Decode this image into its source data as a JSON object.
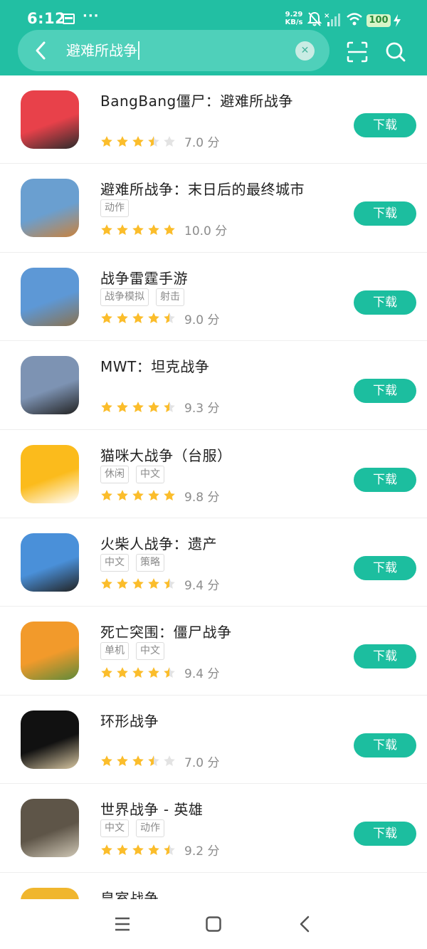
{
  "status_bar": {
    "time": "6:12",
    "more": "···",
    "net_speed_value": "9.29",
    "net_speed_unit": "KB/s",
    "battery": "100"
  },
  "search": {
    "query": "避难所战争"
  },
  "download_label": "下载",
  "apps": [
    {
      "name": "BangBang僵尸：避难所战争",
      "tags": [],
      "rating": 3.5,
      "score": "7.0 分",
      "icon_colors": [
        "#e8414a",
        "#2b2b2b"
      ]
    },
    {
      "name": "避难所战争：末日后的最终城市",
      "tags": [
        "动作"
      ],
      "rating": 5,
      "score": "10.0 分",
      "icon_colors": [
        "#6a9fd0",
        "#c9823d"
      ]
    },
    {
      "name": "战争雷霆手游",
      "tags": [
        "战争模拟",
        "射击"
      ],
      "rating": 4.5,
      "score": "9.0 分",
      "icon_colors": [
        "#5d98d6",
        "#8a7250"
      ]
    },
    {
      "name": "MWT：坦克战争",
      "tags": [],
      "rating": 4.5,
      "score": "9.3 分",
      "icon_colors": [
        "#7d93b3",
        "#222222"
      ]
    },
    {
      "name": "猫咪大战争（台服）",
      "tags": [
        "休闲",
        "中文"
      ],
      "rating": 5,
      "score": "9.8 分",
      "icon_colors": [
        "#fbbb1c",
        "#ffffff"
      ]
    },
    {
      "name": "火柴人战争：遗产",
      "tags": [
        "中文",
        "策略"
      ],
      "rating": 4.5,
      "score": "9.4 分",
      "icon_colors": [
        "#4a90d9",
        "#222222"
      ]
    },
    {
      "name": "死亡突围：僵尸战争",
      "tags": [
        "单机",
        "中文"
      ],
      "rating": 4.5,
      "score": "9.4 分",
      "icon_colors": [
        "#f29a2b",
        "#5e8a3a"
      ]
    },
    {
      "name": "环形战争",
      "tags": [],
      "rating": 3.5,
      "score": "7.0 分",
      "icon_colors": [
        "#111111",
        "#d8c7a2"
      ]
    },
    {
      "name": "世界战争 - 英雄",
      "tags": [
        "中文",
        "动作"
      ],
      "rating": 4.5,
      "score": "9.2 分",
      "icon_colors": [
        "#5e5548",
        "#cfc7b5"
      ]
    },
    {
      "name": "皇室战争",
      "tags": [],
      "rating": 0,
      "score": "",
      "icon_colors": [
        "#f0b62e",
        "#d4462f"
      ]
    }
  ],
  "colors": {
    "accent": "#22bfa3",
    "button": "#1cbe9f",
    "star": "#fbbd2b",
    "star_empty": "#e3e3e3"
  },
  "icons": {
    "back": "chevron-left-icon",
    "clear": "close-icon",
    "scan": "scan-icon",
    "search": "search-icon",
    "nav_menu": "menu-icon",
    "nav_home": "home-square-icon",
    "nav_back": "back-triangle-icon"
  }
}
